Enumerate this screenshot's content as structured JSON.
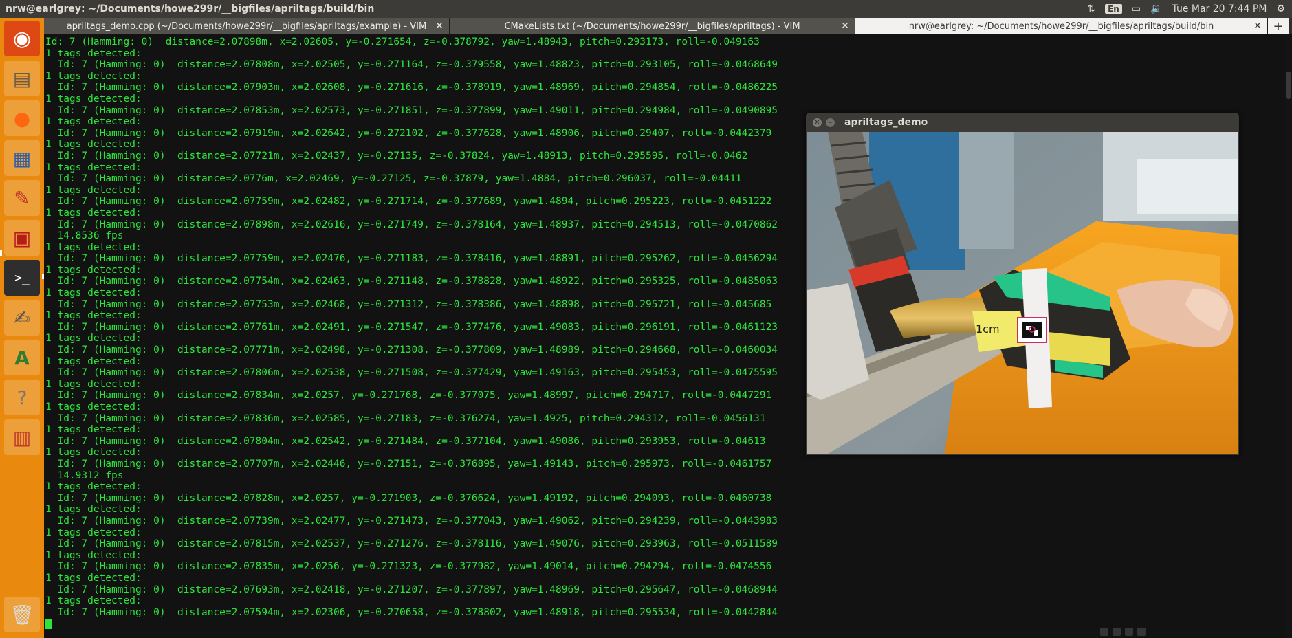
{
  "top_panel": {
    "title": "nrw@earlgrey: ~/Documents/howe299r/__bigfiles/apriltags/build/bin",
    "keyboard": "En",
    "clock": "Tue Mar 20  7:44 PM"
  },
  "tabs": [
    {
      "label": "apriltags_demo.cpp (~/Documents/howe299r/__bigfiles/apriltags/example) - VIM",
      "active": false
    },
    {
      "label": "CMakeLists.txt (~/Documents/howe299r/__bigfiles/apriltags) - VIM",
      "active": false
    },
    {
      "label": "nrw@earlgrey: ~/Documents/howe299r/__bigfiles/apriltags/build/bin",
      "active": true
    }
  ],
  "tab_add_label": "+",
  "terminal": {
    "lines": [
      "Id: 7 (Hamming: 0)  distance=2.07898m, x=2.02605, y=-0.271654, z=-0.378792, yaw=1.48943, pitch=0.293173, roll=-0.049163",
      "1 tags detected:",
      "  Id: 7 (Hamming: 0)  distance=2.07808m, x=2.02505, y=-0.271164, z=-0.379558, yaw=1.48823, pitch=0.293105, roll=-0.0468649",
      "1 tags detected:",
      "  Id: 7 (Hamming: 0)  distance=2.07903m, x=2.02608, y=-0.271616, z=-0.378919, yaw=1.48969, pitch=0.294854, roll=-0.0486225",
      "1 tags detected:",
      "  Id: 7 (Hamming: 0)  distance=2.07853m, x=2.02573, y=-0.271851, z=-0.377899, yaw=1.49011, pitch=0.294984, roll=-0.0490895",
      "1 tags detected:",
      "  Id: 7 (Hamming: 0)  distance=2.07919m, x=2.02642, y=-0.272102, z=-0.377628, yaw=1.48906, pitch=0.29407, roll=-0.0442379",
      "1 tags detected:",
      "  Id: 7 (Hamming: 0)  distance=2.07721m, x=2.02437, y=-0.27135, z=-0.37824, yaw=1.48913, pitch=0.295595, roll=-0.0462",
      "1 tags detected:",
      "  Id: 7 (Hamming: 0)  distance=2.0776m, x=2.02469, y=-0.27125, z=-0.37879, yaw=1.4884, pitch=0.296037, roll=-0.04411",
      "1 tags detected:",
      "  Id: 7 (Hamming: 0)  distance=2.07759m, x=2.02482, y=-0.271714, z=-0.377689, yaw=1.4894, pitch=0.295223, roll=-0.0451222",
      "1 tags detected:",
      "  Id: 7 (Hamming: 0)  distance=2.07898m, x=2.02616, y=-0.271749, z=-0.378164, yaw=1.48937, pitch=0.294513, roll=-0.0470862",
      "  14.8536 fps",
      "1 tags detected:",
      "  Id: 7 (Hamming: 0)  distance=2.07759m, x=2.02476, y=-0.271183, z=-0.378416, yaw=1.48891, pitch=0.295262, roll=-0.0456294",
      "1 tags detected:",
      "  Id: 7 (Hamming: 0)  distance=2.07754m, x=2.02463, y=-0.271148, z=-0.378828, yaw=1.48922, pitch=0.295325, roll=-0.0485063",
      "1 tags detected:",
      "  Id: 7 (Hamming: 0)  distance=2.07753m, x=2.02468, y=-0.271312, z=-0.378386, yaw=1.48898, pitch=0.295721, roll=-0.045685",
      "1 tags detected:",
      "  Id: 7 (Hamming: 0)  distance=2.07761m, x=2.02491, y=-0.271547, z=-0.377476, yaw=1.49083, pitch=0.296191, roll=-0.0461123",
      "1 tags detected:",
      "  Id: 7 (Hamming: 0)  distance=2.07771m, x=2.02498, y=-0.271308, z=-0.377809, yaw=1.48989, pitch=0.294668, roll=-0.0460034",
      "1 tags detected:",
      "  Id: 7 (Hamming: 0)  distance=2.07806m, x=2.02538, y=-0.271508, z=-0.377429, yaw=1.49163, pitch=0.295453, roll=-0.0475595",
      "1 tags detected:",
      "  Id: 7 (Hamming: 0)  distance=2.07834m, x=2.0257, y=-0.271768, z=-0.377075, yaw=1.48997, pitch=0.294717, roll=-0.0447291",
      "1 tags detected:",
      "  Id: 7 (Hamming: 0)  distance=2.07836m, x=2.02585, y=-0.27183, z=-0.376274, yaw=1.4925, pitch=0.294312, roll=-0.0456131",
      "1 tags detected:",
      "  Id: 7 (Hamming: 0)  distance=2.07804m, x=2.02542, y=-0.271484, z=-0.377104, yaw=1.49086, pitch=0.293953, roll=-0.04613",
      "1 tags detected:",
      "  Id: 7 (Hamming: 0)  distance=2.07707m, x=2.02446, y=-0.27151, z=-0.376895, yaw=1.49143, pitch=0.295973, roll=-0.0461757",
      "  14.9312 fps",
      "1 tags detected:",
      "  Id: 7 (Hamming: 0)  distance=2.07828m, x=2.0257, y=-0.271903, z=-0.376624, yaw=1.49192, pitch=0.294093, roll=-0.0460738",
      "1 tags detected:",
      "  Id: 7 (Hamming: 0)  distance=2.07739m, x=2.02477, y=-0.271473, z=-0.377043, yaw=1.49062, pitch=0.294239, roll=-0.0443983",
      "1 tags detected:",
      "  Id: 7 (Hamming: 0)  distance=2.07815m, x=2.02537, y=-0.271276, z=-0.378116, yaw=1.49076, pitch=0.293963, roll=-0.0511589",
      "1 tags detected:",
      "  Id: 7 (Hamming: 0)  distance=2.07835m, x=2.0256, y=-0.271323, z=-0.377982, yaw=1.49014, pitch=0.294294, roll=-0.0474556",
      "1 tags detected:",
      "  Id: 7 (Hamming: 0)  distance=2.07693m, x=2.02418, y=-0.271207, z=-0.377897, yaw=1.48969, pitch=0.295647, roll=-0.0468944",
      "1 tags detected:",
      "  Id: 7 (Hamming: 0)  distance=2.07594m, x=2.02306, y=-0.270658, z=-0.378802, yaw=1.48918, pitch=0.295534, roll=-0.0442844"
    ]
  },
  "demo_window": {
    "title": "apriltags_demo",
    "tag_label": "1cm"
  },
  "launcher": {
    "items": [
      {
        "name": "ubuntu-dash-icon",
        "glyph": "◉"
      },
      {
        "name": "files-icon",
        "glyph": "▤"
      },
      {
        "name": "firefox-icon",
        "glyph": "●"
      },
      {
        "name": "document-viewer-icon",
        "glyph": "▦"
      },
      {
        "name": "system-settings-icon",
        "glyph": "✎"
      },
      {
        "name": "system-monitor-icon",
        "glyph": "▣"
      },
      {
        "name": "terminal-icon",
        "glyph": ">_"
      },
      {
        "name": "text-editor-icon",
        "glyph": "✍"
      },
      {
        "name": "software-updater-icon",
        "glyph": "A"
      },
      {
        "name": "help-icon",
        "glyph": "?"
      },
      {
        "name": "workspace-switcher-icon",
        "glyph": "▥"
      },
      {
        "name": "trash-icon",
        "glyph": "🗑"
      }
    ]
  },
  "colors": {
    "terminal_text": "#2ce43a",
    "launcher_bg": "#e98a0f",
    "panel_bg": "#3c3b37"
  }
}
